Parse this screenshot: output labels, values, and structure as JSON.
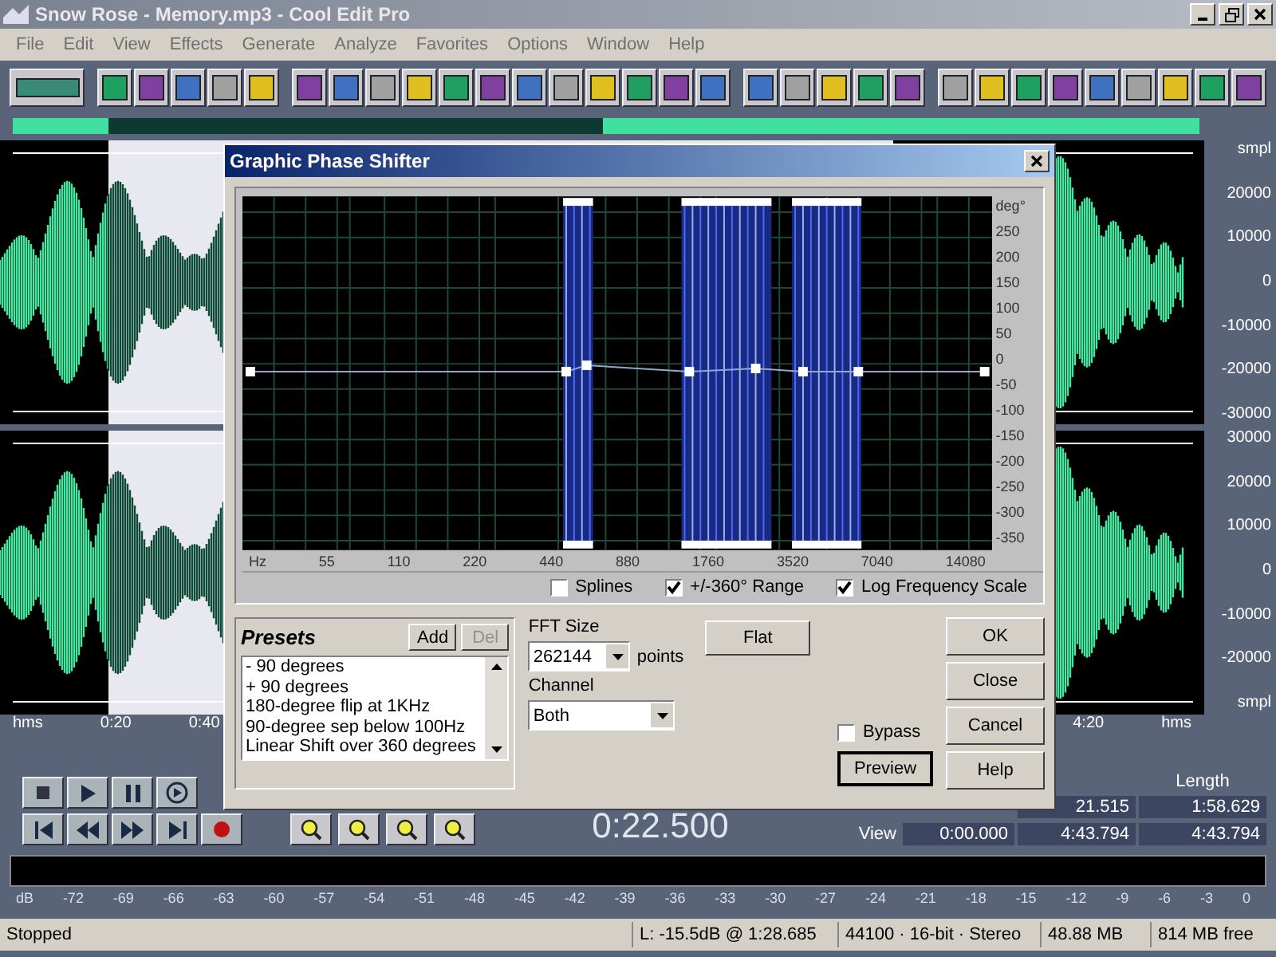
{
  "app_window": {
    "title": "Snow Rose - Memory.mp3 - Cool Edit Pro"
  },
  "menu": [
    "File",
    "Edit",
    "View",
    "Effects",
    "Generate",
    "Analyze",
    "Favorites",
    "Options",
    "Window",
    "Help"
  ],
  "waveform": {
    "top_scale": [
      "smpl",
      "20000",
      "10000",
      "0",
      "-10000",
      "-20000",
      "-30000"
    ],
    "bottom_scale": [
      "30000",
      "20000",
      "10000",
      "0",
      "-10000",
      "-20000",
      "smpl"
    ],
    "ruler_left": [
      "hms",
      "0:20",
      "0:40"
    ],
    "ruler_right": [
      "4:20",
      "hms"
    ]
  },
  "transport": {
    "time": "0:22.500"
  },
  "selection_panel": {
    "length_header": "Length",
    "end": "21.515",
    "length": "1:58.629",
    "view_label": "View",
    "view_begin": "0:00.000",
    "view_end": "4:43.794",
    "view_length": "4:43.794"
  },
  "level_meter": {
    "scale": [
      "dB",
      "-72",
      "-69",
      "-66",
      "-63",
      "-60",
      "-57",
      "-54",
      "-51",
      "-48",
      "-45",
      "-42",
      "-39",
      "-36",
      "-33",
      "-30",
      "-27",
      "-24",
      "-21",
      "-18",
      "-15",
      "-12",
      "-9",
      "-6",
      "-3",
      "0"
    ]
  },
  "status_bar": [
    "Stopped",
    "L: -15.5dB @  1:28.685",
    "44100 · 16-bit · Stereo",
    "48.88 MB",
    "814 MB free"
  ],
  "dialog": {
    "title": "Graphic Phase Shifter",
    "graph": {
      "y_labels": [
        "deg°",
        "250",
        "200",
        "150",
        "100",
        "50",
        "0",
        "-50",
        "-100",
        "-150",
        "-200",
        "-250",
        "-300",
        "-350"
      ],
      "x_labels": [
        "Hz",
        "55",
        "110",
        "220",
        "440",
        "880",
        "1760",
        "3520",
        "7040",
        "14080"
      ]
    },
    "options": [
      {
        "label": "Splines",
        "checked": false
      },
      {
        "label": "+/-360° Range",
        "checked": true
      },
      {
        "label": "Log Frequency Scale",
        "checked": true
      }
    ],
    "presets": {
      "title": "Presets",
      "buttons": [
        {
          "label": "Add",
          "disabled": false
        },
        {
          "label": "Del",
          "disabled": true
        }
      ],
      "items": [
        "- 90 degrees",
        "+ 90 degrees",
        "180-degree flip at 1KHz",
        "90-degree sep below 100Hz",
        "Linear Shift over 360 degrees"
      ]
    },
    "fft_size": {
      "label": "FFT Size",
      "value": "262144",
      "unit": "points"
    },
    "channel": {
      "label": "Channel",
      "value": "Both"
    },
    "flat_button": "Flat",
    "bypass": {
      "label": "Bypass",
      "checked": false
    },
    "preview_button": "Preview",
    "side_buttons": [
      "OK",
      "Close",
      "Cancel",
      "Help"
    ]
  }
}
